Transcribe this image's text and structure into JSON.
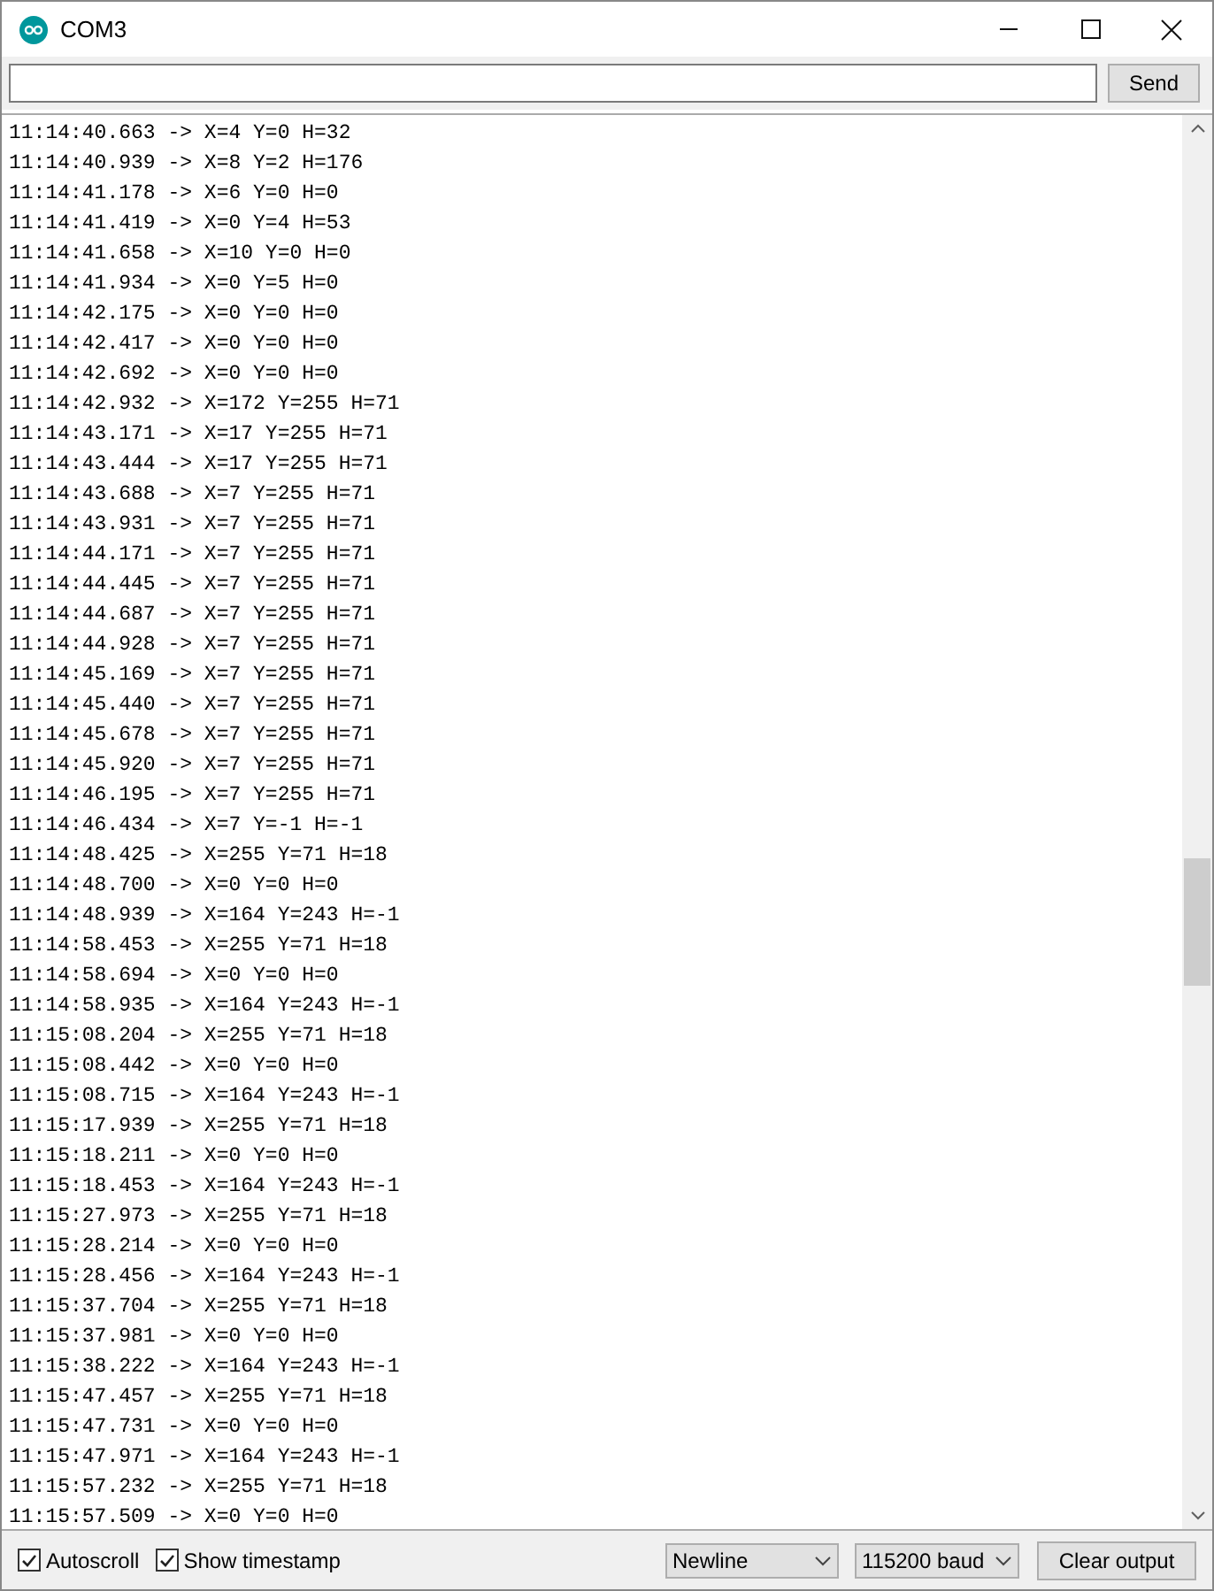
{
  "window": {
    "title": "COM3"
  },
  "send_button": "Send",
  "lines": [
    "11:14:40.663 -> X=4 Y=0 H=32",
    "11:14:40.939 -> X=8 Y=2 H=176",
    "11:14:41.178 -> X=6 Y=0 H=0",
    "11:14:41.419 -> X=0 Y=4 H=53",
    "11:14:41.658 -> X=10 Y=0 H=0",
    "11:14:41.934 -> X=0 Y=5 H=0",
    "11:14:42.175 -> X=0 Y=0 H=0",
    "11:14:42.417 -> X=0 Y=0 H=0",
    "11:14:42.692 -> X=0 Y=0 H=0",
    "11:14:42.932 -> X=172 Y=255 H=71",
    "11:14:43.171 -> X=17 Y=255 H=71",
    "11:14:43.444 -> X=17 Y=255 H=71",
    "11:14:43.688 -> X=7 Y=255 H=71",
    "11:14:43.931 -> X=7 Y=255 H=71",
    "11:14:44.171 -> X=7 Y=255 H=71",
    "11:14:44.445 -> X=7 Y=255 H=71",
    "11:14:44.687 -> X=7 Y=255 H=71",
    "11:14:44.928 -> X=7 Y=255 H=71",
    "11:14:45.169 -> X=7 Y=255 H=71",
    "11:14:45.440 -> X=7 Y=255 H=71",
    "11:14:45.678 -> X=7 Y=255 H=71",
    "11:14:45.920 -> X=7 Y=255 H=71",
    "11:14:46.195 -> X=7 Y=255 H=71",
    "11:14:46.434 -> X=7 Y=-1 H=-1",
    "11:14:48.425 -> X=255 Y=71 H=18",
    "11:14:48.700 -> X=0 Y=0 H=0",
    "11:14:48.939 -> X=164 Y=243 H=-1",
    "11:14:58.453 -> X=255 Y=71 H=18",
    "11:14:58.694 -> X=0 Y=0 H=0",
    "11:14:58.935 -> X=164 Y=243 H=-1",
    "11:15:08.204 -> X=255 Y=71 H=18",
    "11:15:08.442 -> X=0 Y=0 H=0",
    "11:15:08.715 -> X=164 Y=243 H=-1",
    "11:15:17.939 -> X=255 Y=71 H=18",
    "11:15:18.211 -> X=0 Y=0 H=0",
    "11:15:18.453 -> X=164 Y=243 H=-1",
    "11:15:27.973 -> X=255 Y=71 H=18",
    "11:15:28.214 -> X=0 Y=0 H=0",
    "11:15:28.456 -> X=164 Y=243 H=-1",
    "11:15:37.704 -> X=255 Y=71 H=18",
    "11:15:37.981 -> X=0 Y=0 H=0",
    "11:15:38.222 -> X=164 Y=243 H=-1",
    "11:15:47.457 -> X=255 Y=71 H=18",
    "11:15:47.731 -> X=0 Y=0 H=0",
    "11:15:47.971 -> X=164 Y=243 H=-1",
    "11:15:57.232 -> X=255 Y=71 H=18",
    "11:15:57.509 -> X=0 Y=0 H=0"
  ],
  "options": [
    {
      "label": "Autoscroll",
      "checked": true
    },
    {
      "label": "Show timestamp",
      "checked": true
    }
  ],
  "line_ending": "Newline",
  "baud_rate": "115200 baud",
  "clear_button": "Clear output"
}
